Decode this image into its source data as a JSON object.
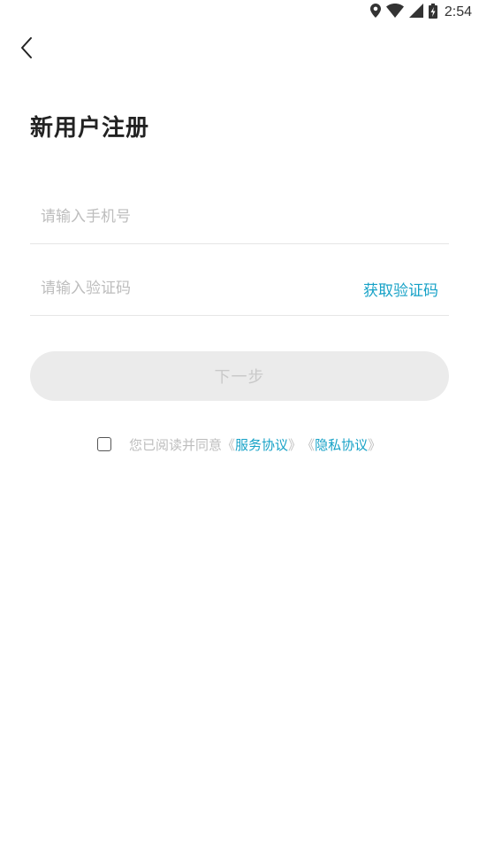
{
  "status_bar": {
    "time": "2:54",
    "icons": [
      "location-icon",
      "wifi-icon",
      "signal-icon",
      "battery-charging-icon"
    ]
  },
  "header": {
    "back_icon": "chevron-left-icon"
  },
  "title": "新用户注册",
  "form": {
    "phone": {
      "value": "",
      "placeholder": "请输入手机号"
    },
    "code": {
      "value": "",
      "placeholder": "请输入验证码",
      "get_code_label": "获取验证码"
    },
    "next_label": "下一步"
  },
  "agreement": {
    "checked": false,
    "prefix": "您已阅读并同意",
    "open_bracket": "《",
    "close_bracket": "》",
    "service_label": "服务协议",
    "privacy_label": "隐私协议"
  },
  "colors": {
    "accent": "#17a2c7",
    "title": "#222222",
    "placeholder": "#bdbdbd",
    "button_disabled_bg": "#ebebeb",
    "button_disabled_text": "#c9c9c9",
    "divider": "#e6e6e6"
  }
}
